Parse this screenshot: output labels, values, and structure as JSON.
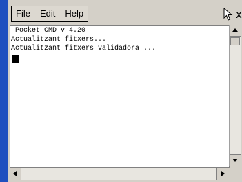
{
  "menubar": {
    "items": [
      {
        "label": "File"
      },
      {
        "label": "Edit"
      },
      {
        "label": "Help"
      }
    ],
    "close_glyph": "x"
  },
  "console": {
    "lines": [
      " Pocket CMD v 4.20",
      "Actualitzant fitxers...",
      "Actualitzant fitxers validadora ..."
    ]
  },
  "icons": {
    "cursor": "mouse-pointer-icon",
    "close": "close-icon"
  },
  "colors": {
    "desktop": "#2558c8",
    "window": "#d4d0c8",
    "console_bg": "#ffffff"
  }
}
